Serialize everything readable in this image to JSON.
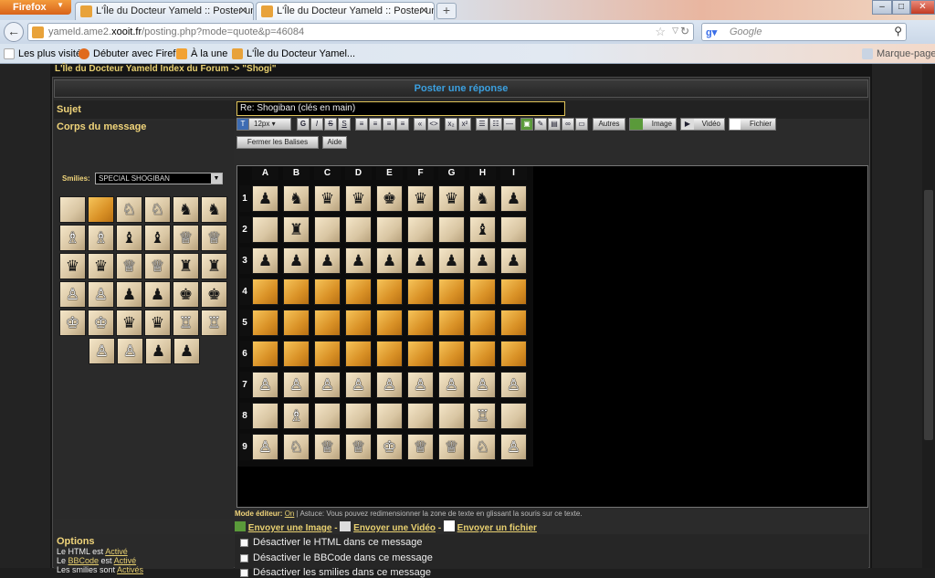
{
  "browser": {
    "app_button": "Firefox",
    "tabs": [
      {
        "label": "L'Île du Docteur Yameld :: Poster une ..."
      },
      {
        "label": "L'Île du Docteur Yameld :: Poster une ..."
      }
    ],
    "url_prefix": "yameld.ame2.",
    "url_host": "xooit.fr",
    "url_path": "/posting.php?mode=quote&p=46084",
    "search_placeholder": "Google",
    "bookmarks": [
      "Les plus visités",
      "Débuter avec Firefox",
      "À la une",
      "L'Île du Docteur Yamel..."
    ],
    "bookmarks_right": "Marque-pages"
  },
  "forum": {
    "breadcrumb": "L'Île du Docteur Yameld Index du Forum -> \"Shogi\"",
    "panel_title": "Poster une réponse",
    "subject_label": "Sujet",
    "subject_value": "Re: Shogiban (clés en main)",
    "body_label": "Corps du message",
    "smilies_label": "Smilies:",
    "smilies_selected": "SPECIAL SHOGIBAN",
    "toolbar": {
      "font_size": "12px",
      "btn_autres": "Autres",
      "btn_image": "Image",
      "btn_video": "Vidéo",
      "btn_fichier": "Fichier",
      "btn_close_tags": "Fermer les Balises",
      "btn_aide": "Aide"
    },
    "mode_label": "Mode éditeur:",
    "mode_value": "On",
    "mode_hint": "| Astuce: Vous pouvez redimensionner la zone de texte en glissant la souris sur ce texte.",
    "send_image": "Envoyer une Image",
    "send_video": "Envoyer une Vidéo",
    "send_file": "Envoyer un fichier",
    "options_title": "Options",
    "options_lines": [
      {
        "pre": "Le HTML est ",
        "link": "Activé"
      },
      {
        "pre": "Le ",
        "link": "BBCode",
        "mid": " est ",
        "link2": "Activé"
      },
      {
        "pre": "Les smilies sont ",
        "link": "Activés"
      }
    ],
    "checkboxes": [
      "Désactiver le HTML dans ce message",
      "Désactiver le BBCode dans ce message",
      "Désactiver les smilies dans ce message"
    ]
  },
  "board": {
    "columns": [
      "A",
      "B",
      "C",
      "D",
      "E",
      "F",
      "G",
      "H",
      "I"
    ],
    "rows": [
      "1",
      "2",
      "3",
      "4",
      "5",
      "6",
      "7",
      "8",
      "9"
    ],
    "squares": [
      [
        "b-lance",
        "b-knight",
        "b-silver",
        "b-gold",
        "b-king",
        "b-gold",
        "b-silver",
        "b-knight",
        "b-lance"
      ],
      [
        "light",
        "b-rook",
        "light",
        "light",
        "light",
        "light",
        "light",
        "b-bishop",
        "light"
      ],
      [
        "b-pawn",
        "b-pawn",
        "b-pawn",
        "b-pawn",
        "b-pawn",
        "b-pawn",
        "b-pawn",
        "b-pawn",
        "b-pawn"
      ],
      [
        "dark",
        "dark",
        "dark",
        "dark",
        "dark",
        "dark",
        "dark",
        "dark",
        "dark"
      ],
      [
        "dark",
        "dark",
        "dark",
        "dark",
        "dark",
        "dark",
        "dark",
        "dark",
        "dark"
      ],
      [
        "dark",
        "dark",
        "dark",
        "dark",
        "dark",
        "dark",
        "dark",
        "dark",
        "dark"
      ],
      [
        "w-pawn",
        "w-pawn",
        "w-pawn",
        "w-pawn",
        "w-pawn",
        "w-pawn",
        "w-pawn",
        "w-pawn",
        "w-pawn"
      ],
      [
        "light",
        "w-bishop",
        "light",
        "light",
        "light",
        "light",
        "light",
        "w-rook",
        "light"
      ],
      [
        "w-lance",
        "w-knight",
        "w-silver",
        "w-gold",
        "w-king",
        "w-gold",
        "w-silver",
        "w-knight",
        "w-lance"
      ]
    ],
    "palette": [
      [
        "light",
        "dark",
        "w-knight",
        "w-knight",
        "b-knight",
        "b-knight"
      ],
      [
        "w-bishop",
        "w-bishop",
        "b-bishop",
        "b-bishop",
        "w-silver",
        "w-silver"
      ],
      [
        "b-silver",
        "b-silver",
        "w-gold",
        "w-gold",
        "b-rook",
        "b-rook"
      ],
      [
        "w-pawn",
        "w-pawn",
        "b-pawn",
        "b-pawn",
        "b-king",
        "b-king"
      ],
      [
        "w-king",
        "w-king",
        "b-gold",
        "b-gold",
        "w-rook",
        "w-rook"
      ],
      [
        "w-lance",
        "w-lance",
        "b-lance",
        "b-lance"
      ]
    ],
    "colors": {
      "dark": "#d99126",
      "light": "#d9c6a3"
    }
  }
}
